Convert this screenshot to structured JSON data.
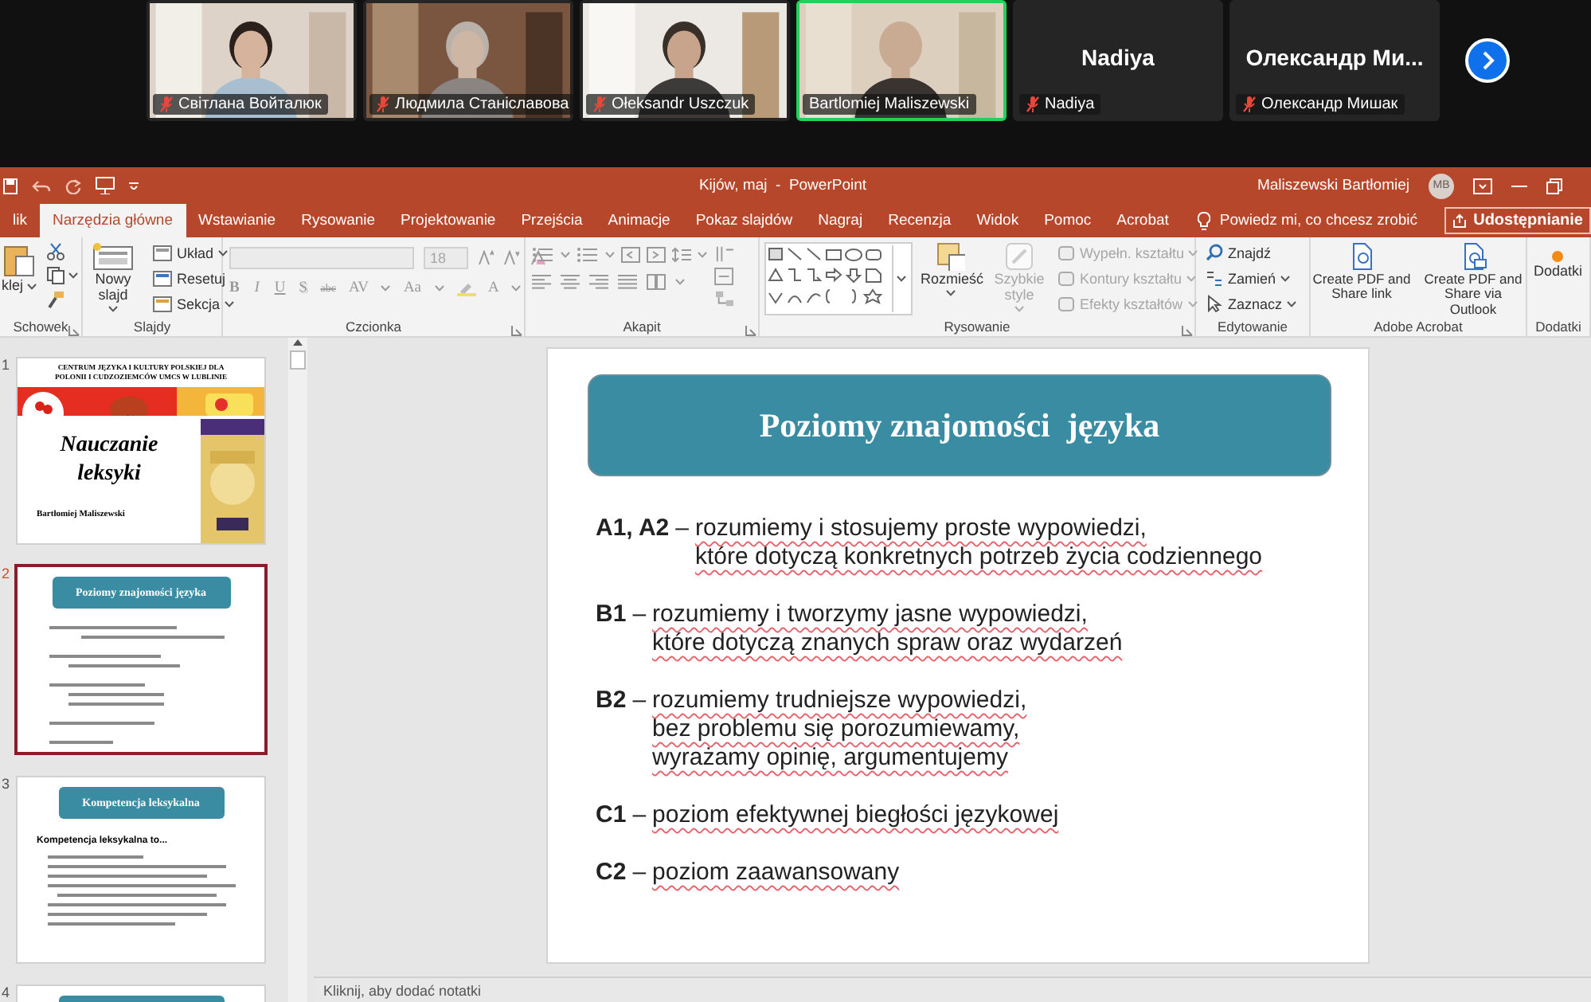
{
  "meeting": {
    "participants": [
      {
        "kind": "video",
        "name": "Світлана Войталюк",
        "muted": true,
        "speaking": false
      },
      {
        "kind": "video",
        "name": "Людмила Станіславова",
        "muted": true,
        "speaking": false
      },
      {
        "kind": "video",
        "name": "Ołeksandr Uszczuk",
        "muted": true,
        "speaking": false
      },
      {
        "kind": "video",
        "name": "Bartlomiej Maliszewski",
        "muted": false,
        "speaking": true
      },
      {
        "kind": "name",
        "display_name": "Nadiya",
        "name": "Nadiya",
        "muted": true,
        "speaking": false
      },
      {
        "kind": "name",
        "display_name": "Олександр  Ми...",
        "name": "Олександр Мишак",
        "muted": true,
        "speaking": false
      }
    ]
  },
  "window": {
    "title": "Kijów, maj  -  PowerPoint",
    "user": "Maliszewski Bartłomiej",
    "avatar": "MB"
  },
  "tabs": [
    {
      "label": "lik",
      "selected": false
    },
    {
      "label": "Narzędzia główne",
      "selected": true
    },
    {
      "label": "Wstawianie",
      "selected": false
    },
    {
      "label": "Rysowanie",
      "selected": false
    },
    {
      "label": "Projektowanie",
      "selected": false
    },
    {
      "label": "Przejścia",
      "selected": false
    },
    {
      "label": "Animacje",
      "selected": false
    },
    {
      "label": "Pokaz slajdów",
      "selected": false
    },
    {
      "label": "Nagraj",
      "selected": false
    },
    {
      "label": "Recenzja",
      "selected": false
    },
    {
      "label": "Widok",
      "selected": false
    },
    {
      "label": "Pomoc",
      "selected": false
    },
    {
      "label": "Acrobat",
      "selected": false
    }
  ],
  "tell_me": {
    "placeholder": "Powiedz mi, co chcesz zrobić"
  },
  "share_button": "Udostępnianie",
  "ribbon": {
    "groups": [
      {
        "kind": "clipboard",
        "label": "Schowek",
        "paste": "klej"
      },
      {
        "kind": "slides",
        "label": "Slajdy",
        "new_slide": "Nowy slajd",
        "items": [
          "Układ",
          "Resetuj",
          "Sekcja"
        ]
      },
      {
        "kind": "font",
        "label": "Czcionka",
        "size": "18",
        "disabled": true,
        "buttons": [
          "B",
          "I",
          "U",
          "S",
          "abc",
          "AV",
          "Aa",
          "A"
        ]
      },
      {
        "kind": "paragraph",
        "label": "Akapit"
      },
      {
        "kind": "drawing",
        "label": "Rysowanie",
        "big": [
          {
            "label": "Rozmieść",
            "disabled": false
          },
          {
            "label": "Szybkie style",
            "disabled": true
          }
        ],
        "items": [
          {
            "label": "Wypełn. kształtu",
            "disabled": true
          },
          {
            "label": "Kontury kształtu",
            "disabled": true
          },
          {
            "label": "Efekty kształtów",
            "disabled": true
          }
        ]
      },
      {
        "kind": "editing",
        "label": "Edytowanie",
        "items": [
          "Znajdź",
          "Zamień",
          "Zaznacz"
        ]
      },
      {
        "kind": "acrobat",
        "label": "Adobe Acrobat",
        "items": [
          "Create PDF and Share link",
          "Create PDF and Share via Outlook"
        ]
      },
      {
        "kind": "addins",
        "label": "Dodatki",
        "button": "Dodatki"
      }
    ]
  },
  "thumbnails": [
    {
      "number": "1",
      "selected": false,
      "kind": "title",
      "header": "CENTRUM JĘZYKA I KULTURY POLSKIEJ DLA POLONII I CUDZOZIEMCÓW UMCS W LUBLINIE",
      "title": "Nauczanie leksyki",
      "author": "Bartłomiej Maliszewski"
    },
    {
      "number": "2",
      "selected": true,
      "kind": "content",
      "title": "Poziomy znajomości  języka"
    },
    {
      "number": "3",
      "selected": false,
      "kind": "bullets",
      "title": "Kompetencja leksykalna",
      "subtitle": "Kompetencja leksykalna to..."
    },
    {
      "number": "4",
      "selected": false,
      "kind": "partial"
    }
  ],
  "slide": {
    "title": "Poziomy znajomości  języka",
    "entries": [
      {
        "label": "A1, A2",
        "dash": "–",
        "lines": [
          "rozumiemy i stosujemy proste wypowiedzi,",
          "które dotyczą konkretnych potrzeb życia codziennego"
        ]
      },
      {
        "label": "B1",
        "dash": "–",
        "lines": [
          "rozumiemy i tworzymy jasne wypowiedzi,",
          "które dotyczą znanych spraw oraz wydarzeń"
        ]
      },
      {
        "label": "B2",
        "dash": "–",
        "lines": [
          "rozumiemy trudniejsze wypowiedzi,",
          "bez problemu się porozumiewamy,",
          "wyrażamy opinię, argumentujemy"
        ]
      },
      {
        "label": "C1",
        "dash": "–",
        "lines": [
          "poziom efektywnej biegłości językowej"
        ]
      },
      {
        "label": "C2",
        "dash": "–",
        "lines": [
          "poziom zaawansowany"
        ]
      }
    ]
  },
  "notes": {
    "placeholder": "Kliknij, aby dodać notatki"
  }
}
